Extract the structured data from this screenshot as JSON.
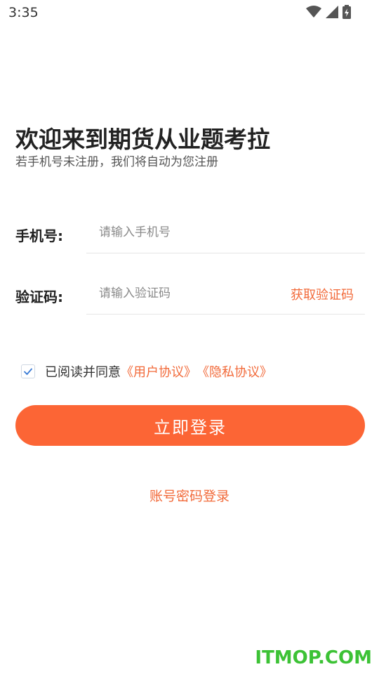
{
  "status_bar": {
    "time": "3:35",
    "icons": [
      "wifi-icon",
      "signal-icon",
      "battery-charging-icon"
    ]
  },
  "header": {
    "title": "欢迎来到期货从业题考拉",
    "subtitle": "若手机号未注册，我们将自动为您注册"
  },
  "form": {
    "phone_label": "手机号:",
    "phone_placeholder": "请输入手机号",
    "phone_value": "",
    "code_label": "验证码:",
    "code_placeholder": "请输入验证码",
    "code_value": "",
    "get_code_label": "获取验证码"
  },
  "agreement": {
    "checked": true,
    "text": "已阅读并同意",
    "user_agreement": "《用户协议》",
    "privacy_agreement": "《隐私协议》"
  },
  "login_button": "立即登录",
  "alt_login": "账号密码登录",
  "watermark": "ITMOP.COM",
  "colors": {
    "accent": "#fc6535",
    "link": "#f26a3a",
    "watermark": "#3cc235"
  }
}
